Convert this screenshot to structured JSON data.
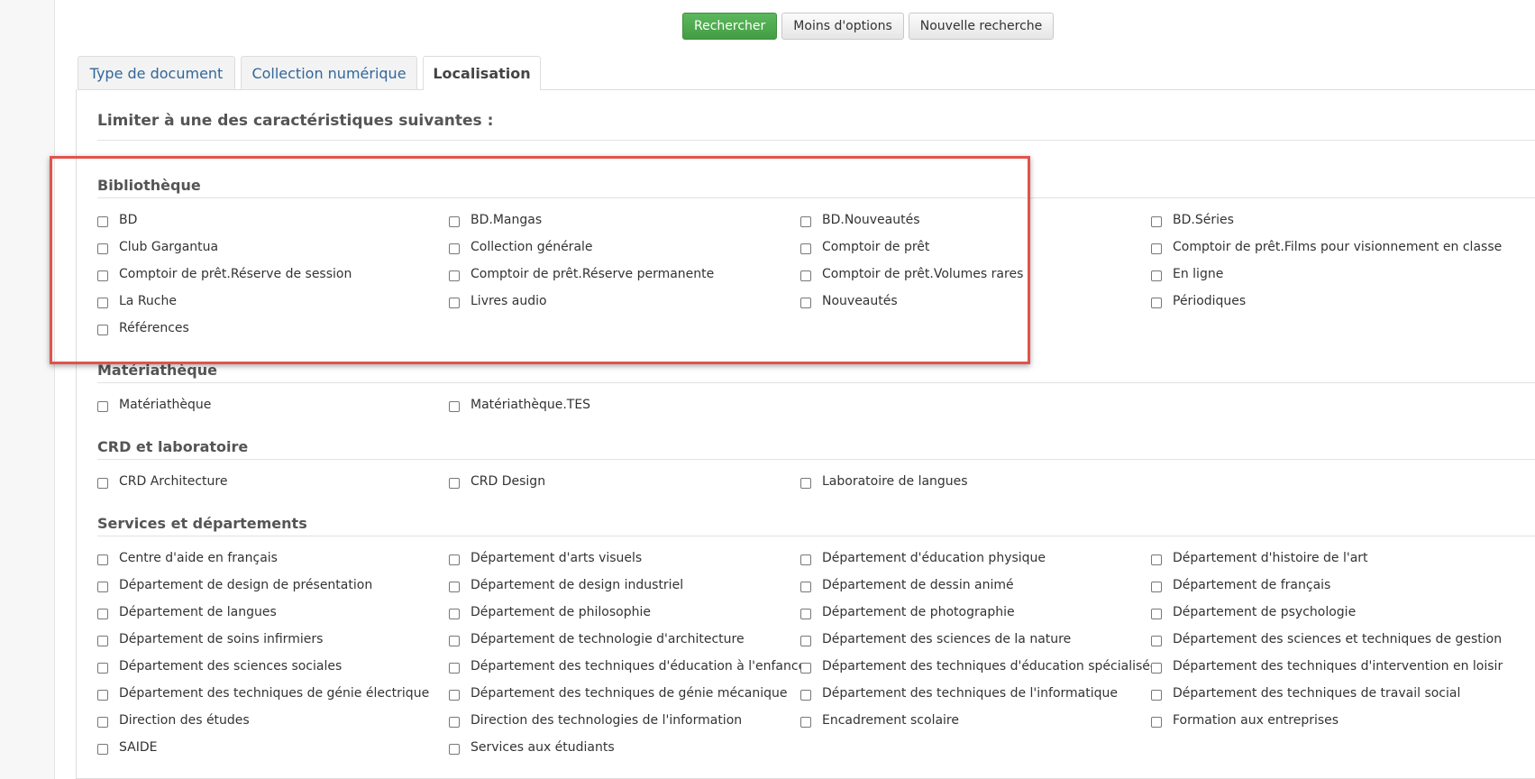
{
  "toolbar": {
    "search_label": "Rechercher",
    "fewer_options_label": "Moins d'options",
    "new_search_label": "Nouvelle recherche"
  },
  "tabs": [
    {
      "label": "Type de document",
      "active": false
    },
    {
      "label": "Collection numérique",
      "active": false
    },
    {
      "label": "Localisation",
      "active": true
    }
  ],
  "panel": {
    "title": "Limiter à une des caractéristiques suivantes :"
  },
  "groups": [
    {
      "title": "Bibliothèque",
      "items": [
        "BD",
        "BD.Mangas",
        "BD.Nouveautés",
        "BD.Séries",
        "Club Gargantua",
        "Collection générale",
        "Comptoir de prêt",
        "Comptoir de prêt.Films pour visionnement en classe",
        "Comptoir de prêt.Réserve de session",
        "Comptoir de prêt.Réserve permanente",
        "Comptoir de prêt.Volumes rares",
        "En ligne",
        "La Ruche",
        "Livres audio",
        "Nouveautés",
        "Périodiques",
        "Références"
      ]
    },
    {
      "title": "Matériathèque",
      "items": [
        "Matériathèque",
        "Matériathèque.TES"
      ]
    },
    {
      "title": "CRD et laboratoire",
      "items": [
        "CRD Architecture",
        "CRD Design",
        "Laboratoire de langues"
      ]
    },
    {
      "title": "Services et départements",
      "items": [
        "Centre d'aide en français",
        "Département d'arts visuels",
        "Département d'éducation physique",
        "Département d'histoire de l'art",
        "Département de design de présentation",
        "Département de design industriel",
        "Département de dessin animé",
        "Département de français",
        "Département de langues",
        "Département de philosophie",
        "Département de photographie",
        "Département de psychologie",
        "Département de soins infirmiers",
        "Département de technologie d'architecture",
        "Département des sciences de la nature",
        "Département des sciences et techniques de gestion",
        "Département des sciences sociales",
        "Département des techniques d'éducation à l'enfance",
        "Département des techniques d'éducation spécialisée",
        "Département des techniques d'intervention en loisir",
        "Département des techniques de génie électrique",
        "Département des techniques de génie mécanique",
        "Département des techniques de l'informatique",
        "Département des techniques de travail social",
        "Direction des études",
        "Direction des technologies de l'information",
        "Encadrement scolaire",
        "Formation aux entreprises",
        "SAIDE",
        "Services aux étudiants"
      ]
    }
  ],
  "colors": {
    "primary_button": "#5cb85c",
    "tab_link": "#336699",
    "highlight_box": "#e0544a"
  }
}
